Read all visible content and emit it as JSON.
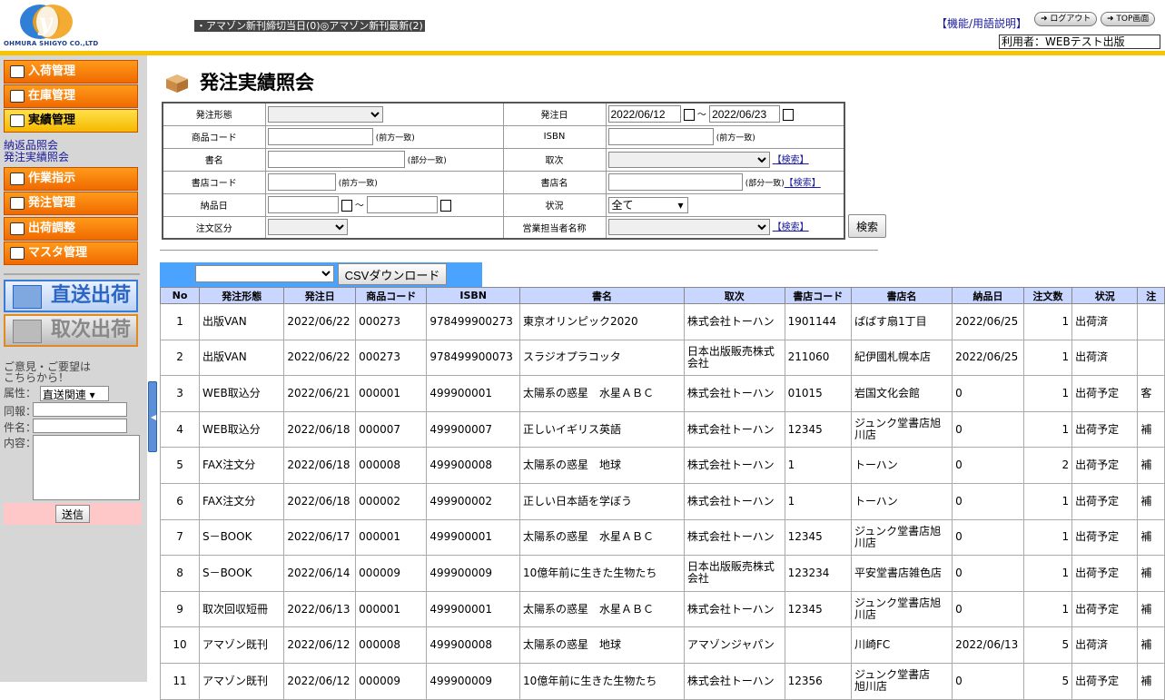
{
  "header": {
    "logo_caption": "OHMURA SHIGYO CO.,LTD",
    "news_items": [
      "アマゾン新刊締切当日(0)",
      "アマゾン新刊最新(2)"
    ],
    "help_link": "【機能/用語説明】",
    "logout_label": "ログアウト",
    "top_label": "TOP画面",
    "user_label": "利用者：WEBテスト出版"
  },
  "sidebar": {
    "nav": [
      {
        "label": "入荷管理",
        "icon": "cart-icon"
      },
      {
        "label": "在庫管理",
        "icon": "box-icon"
      },
      {
        "label": "実績管理",
        "icon": "document-icon"
      }
    ],
    "submenu": [
      "納返品照会",
      "発注実績照会"
    ],
    "nav2": [
      {
        "label": "作業指示",
        "icon": "hand-pointer-icon"
      },
      {
        "label": "発注管理",
        "icon": "hand-document-icon"
      },
      {
        "label": "出荷調整",
        "icon": "cart-icon"
      },
      {
        "label": "マスタ管理",
        "icon": "lock-icon"
      }
    ],
    "direct_ship_label": "直送出荷",
    "distributor_ship_label": "取次出荷",
    "feedback": {
      "intro": "ご意見・ご要望は\nこちらから！",
      "attr_label": "属性：",
      "attr_value": "直送関連",
      "report_label": "同報：",
      "subject_label": "件名：",
      "content_label": "内容：",
      "send_label": "送信"
    }
  },
  "page": {
    "title": "発注実績照会",
    "search_label": "検索",
    "csv_label": "CSVダウンロード"
  },
  "form": {
    "order_type_label": "発注形態",
    "order_date_label": "発注日",
    "order_date_from": "2022/06/12",
    "order_date_to": "2022/06/23",
    "range_sep": "～",
    "product_code_label": "商品コード",
    "prefix_note": "(前方一致)",
    "partial_note": "(部分一致)",
    "isbn_label": "ISBN",
    "title_label": "書名",
    "distributor_label": "取次",
    "search_link": "【検索】",
    "store_code_label": "書店コード",
    "store_name_label": "書店名",
    "delivery_date_label": "納品日",
    "status_label": "状況",
    "status_value": "全て",
    "order_class_label": "注文区分",
    "sales_rep_label": "営業担当者名称"
  },
  "table": {
    "headers": [
      "No",
      "発注形態",
      "発注日",
      "商品コード",
      "ISBN",
      "書名",
      "取次",
      "書店コード",
      "書店名",
      "納品日",
      "注文数",
      "状況",
      "注"
    ],
    "rows": [
      [
        "1",
        "出版VAN",
        "2022/06/22",
        "000273",
        "978499900273",
        "東京オリンピック2020",
        "株式会社トーハン",
        "1901144",
        "ぱぱす扇1丁目",
        "2022/06/25",
        "1",
        "出荷済",
        ""
      ],
      [
        "2",
        "出版VAN",
        "2022/06/22",
        "000273",
        "978499900073",
        "スラジオプラコッタ",
        "日本出版販売株式会社",
        "211060",
        "紀伊國札幌本店",
        "2022/06/25",
        "1",
        "出荷済",
        ""
      ],
      [
        "3",
        "WEB取込分",
        "2022/06/21",
        "000001",
        "499900001",
        "太陽系の惑星　水星ＡＢＣ",
        "株式会社トーハン",
        "01015",
        "岩国文化会館",
        "0",
        "1",
        "出荷予定",
        "客"
      ],
      [
        "4",
        "WEB取込分",
        "2022/06/18",
        "000007",
        "499900007",
        "正しいイギリス英語",
        "株式会社トーハン",
        "12345",
        "ジュンク堂書店旭川店",
        "0",
        "1",
        "出荷予定",
        "補"
      ],
      [
        "5",
        "FAX注文分",
        "2022/06/18",
        "000008",
        "499900008",
        "太陽系の惑星　地球",
        "株式会社トーハン",
        "1",
        "トーハン",
        "0",
        "2",
        "出荷予定",
        "補"
      ],
      [
        "6",
        "FAX注文分",
        "2022/06/18",
        "000002",
        "499900002",
        "正しい日本語を学ぼう",
        "株式会社トーハン",
        "1",
        "トーハン",
        "0",
        "1",
        "出荷予定",
        "補"
      ],
      [
        "7",
        "S－BOOK",
        "2022/06/17",
        "000001",
        "499900001",
        "太陽系の惑星　水星ＡＢＣ",
        "株式会社トーハン",
        "12345",
        "ジュンク堂書店旭川店",
        "0",
        "1",
        "出荷予定",
        "補"
      ],
      [
        "8",
        "S－BOOK",
        "2022/06/14",
        "000009",
        "499900009",
        "10億年前に生きた生物たち",
        "日本出版販売株式会社",
        "123234",
        "平安堂書店雑色店",
        "0",
        "1",
        "出荷予定",
        "補"
      ],
      [
        "9",
        "取次回収短冊",
        "2022/06/13",
        "000001",
        "499900001",
        "太陽系の惑星　水星ＡＢＣ",
        "株式会社トーハン",
        "12345",
        "ジュンク堂書店旭川店",
        "0",
        "1",
        "出荷予定",
        "補"
      ],
      [
        "10",
        "アマゾン既刊",
        "2022/06/12",
        "000008",
        "499900008",
        "太陽系の惑星　地球",
        "アマゾンジャパン",
        "",
        "川崎FC",
        "2022/06/13",
        "5",
        "出荷済",
        "補"
      ],
      [
        "11",
        "アマゾン既刊",
        "2022/06/12",
        "000009",
        "499900009",
        "10億年前に生きた生物たち",
        "株式会社トーハン",
        "12356",
        "ジュンク堂書店　旭川店",
        "0",
        "5",
        "出荷予定",
        "補"
      ]
    ]
  },
  "colors": {
    "nav_orange": "#f07a00",
    "nav_active": "#f5c400",
    "header_rule": "#f7c400",
    "table_header": "#c9d6ff",
    "csv_bar": "#4aa3ff"
  }
}
